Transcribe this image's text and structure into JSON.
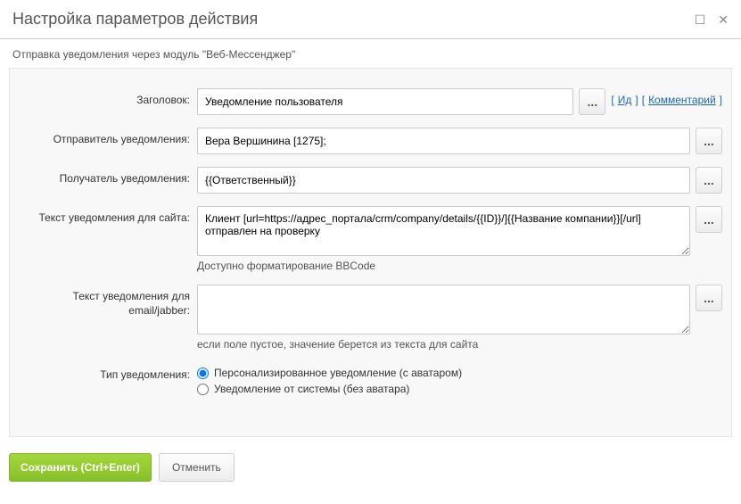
{
  "dialog": {
    "title": "Настройка параметров действия",
    "subtitle": "Отправка уведомления через модуль \"Веб-Мессенджер\""
  },
  "labels": {
    "header": "Заголовок:",
    "sender": "Отправитель уведомления:",
    "recipient": "Получатель уведомления:",
    "site_text": "Текст уведомления для сайта:",
    "email_text": "Текст уведомления для email/jabber:",
    "notif_type": "Тип уведомления:"
  },
  "values": {
    "header": "Уведомление пользователя",
    "sender": "Вера Вершинина [1275];",
    "recipient": "{{Ответственный}}",
    "site_text": "Клиент [url=https://адрес_портала/crm/company/details/{{ID}}/]{{Название компании}}[/url] отправлен на проверку",
    "email_text": ""
  },
  "helpers": {
    "bbcode": "Доступно форматирование BBCode",
    "email_empty": "если поле пустое, значение берется из текста для сайта"
  },
  "links": {
    "id": "Ид",
    "comment": "Комментарий"
  },
  "radio": {
    "personalized": "Персонализированное уведомление (с аватаром)",
    "system": "Уведомление от системы (без аватара)"
  },
  "buttons": {
    "dots": "...",
    "save": "Сохранить (Ctrl+Enter)",
    "cancel": "Отменить"
  }
}
